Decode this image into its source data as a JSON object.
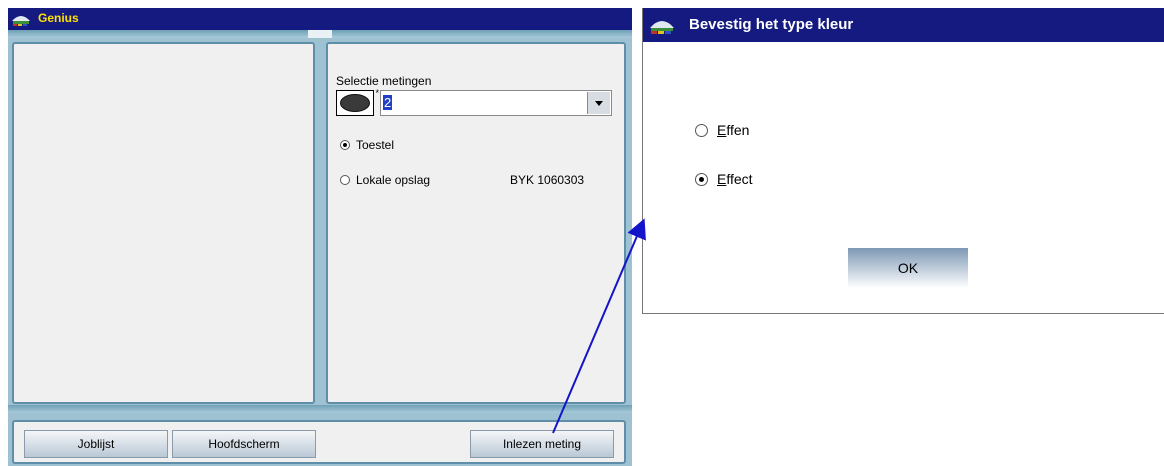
{
  "main_window": {
    "title": "Genius",
    "selection": {
      "label": "Selectie metingen",
      "value": "2",
      "star": "*"
    },
    "source_options": [
      {
        "label": "Toestel",
        "checked": true
      },
      {
        "label": "Lokale opslag",
        "checked": false
      }
    ],
    "device_id": "BYK 1060303",
    "buttons": {
      "joblijst": "Joblijst",
      "hoofdscherm": "Hoofdscherm",
      "inlezen": "Inlezen meting"
    }
  },
  "dialog": {
    "title": "Bevestig het type kleur",
    "options": [
      {
        "mnemonic": "E",
        "rest": "ffen",
        "checked": false
      },
      {
        "mnemonic": "E",
        "rest": "ffect",
        "checked": true
      }
    ],
    "ok_label": "OK"
  },
  "colors": {
    "titlebar": "#141a80",
    "main_title_text": "#ffe000",
    "frame": "#9fc2d2",
    "annotation_arrow": "#1414c8"
  },
  "icons": [
    "app-icon",
    "dropdown-arrow-icon",
    "measurement-ellipse-icon"
  ]
}
